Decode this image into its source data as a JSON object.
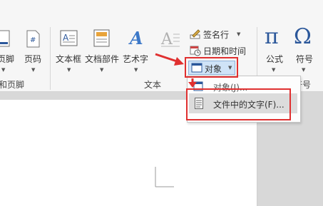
{
  "ribbon": {
    "header_footer": {
      "footer_label": "页脚",
      "page_number_label": "页码",
      "group_label": "和页脚"
    },
    "text_group": {
      "text_box_label": "文本框",
      "quick_parts_label": "文档部件",
      "wordart_label": "艺术字",
      "signature_line_label": "签名行",
      "date_time_label": "日期和时间",
      "object_label": "对象",
      "group_label": "文本"
    },
    "symbols_group": {
      "equation_label": "公式",
      "symbol_label": "符号",
      "group_label": "符号",
      "pi_glyph": "π",
      "omega_glyph": "Ω"
    }
  },
  "object_menu": {
    "item_object": "对象(J)...",
    "item_text_from_file": "文件中的文字(F)..."
  },
  "colors": {
    "highlight_red": "#e03030",
    "accent_blue": "#2b579a"
  }
}
